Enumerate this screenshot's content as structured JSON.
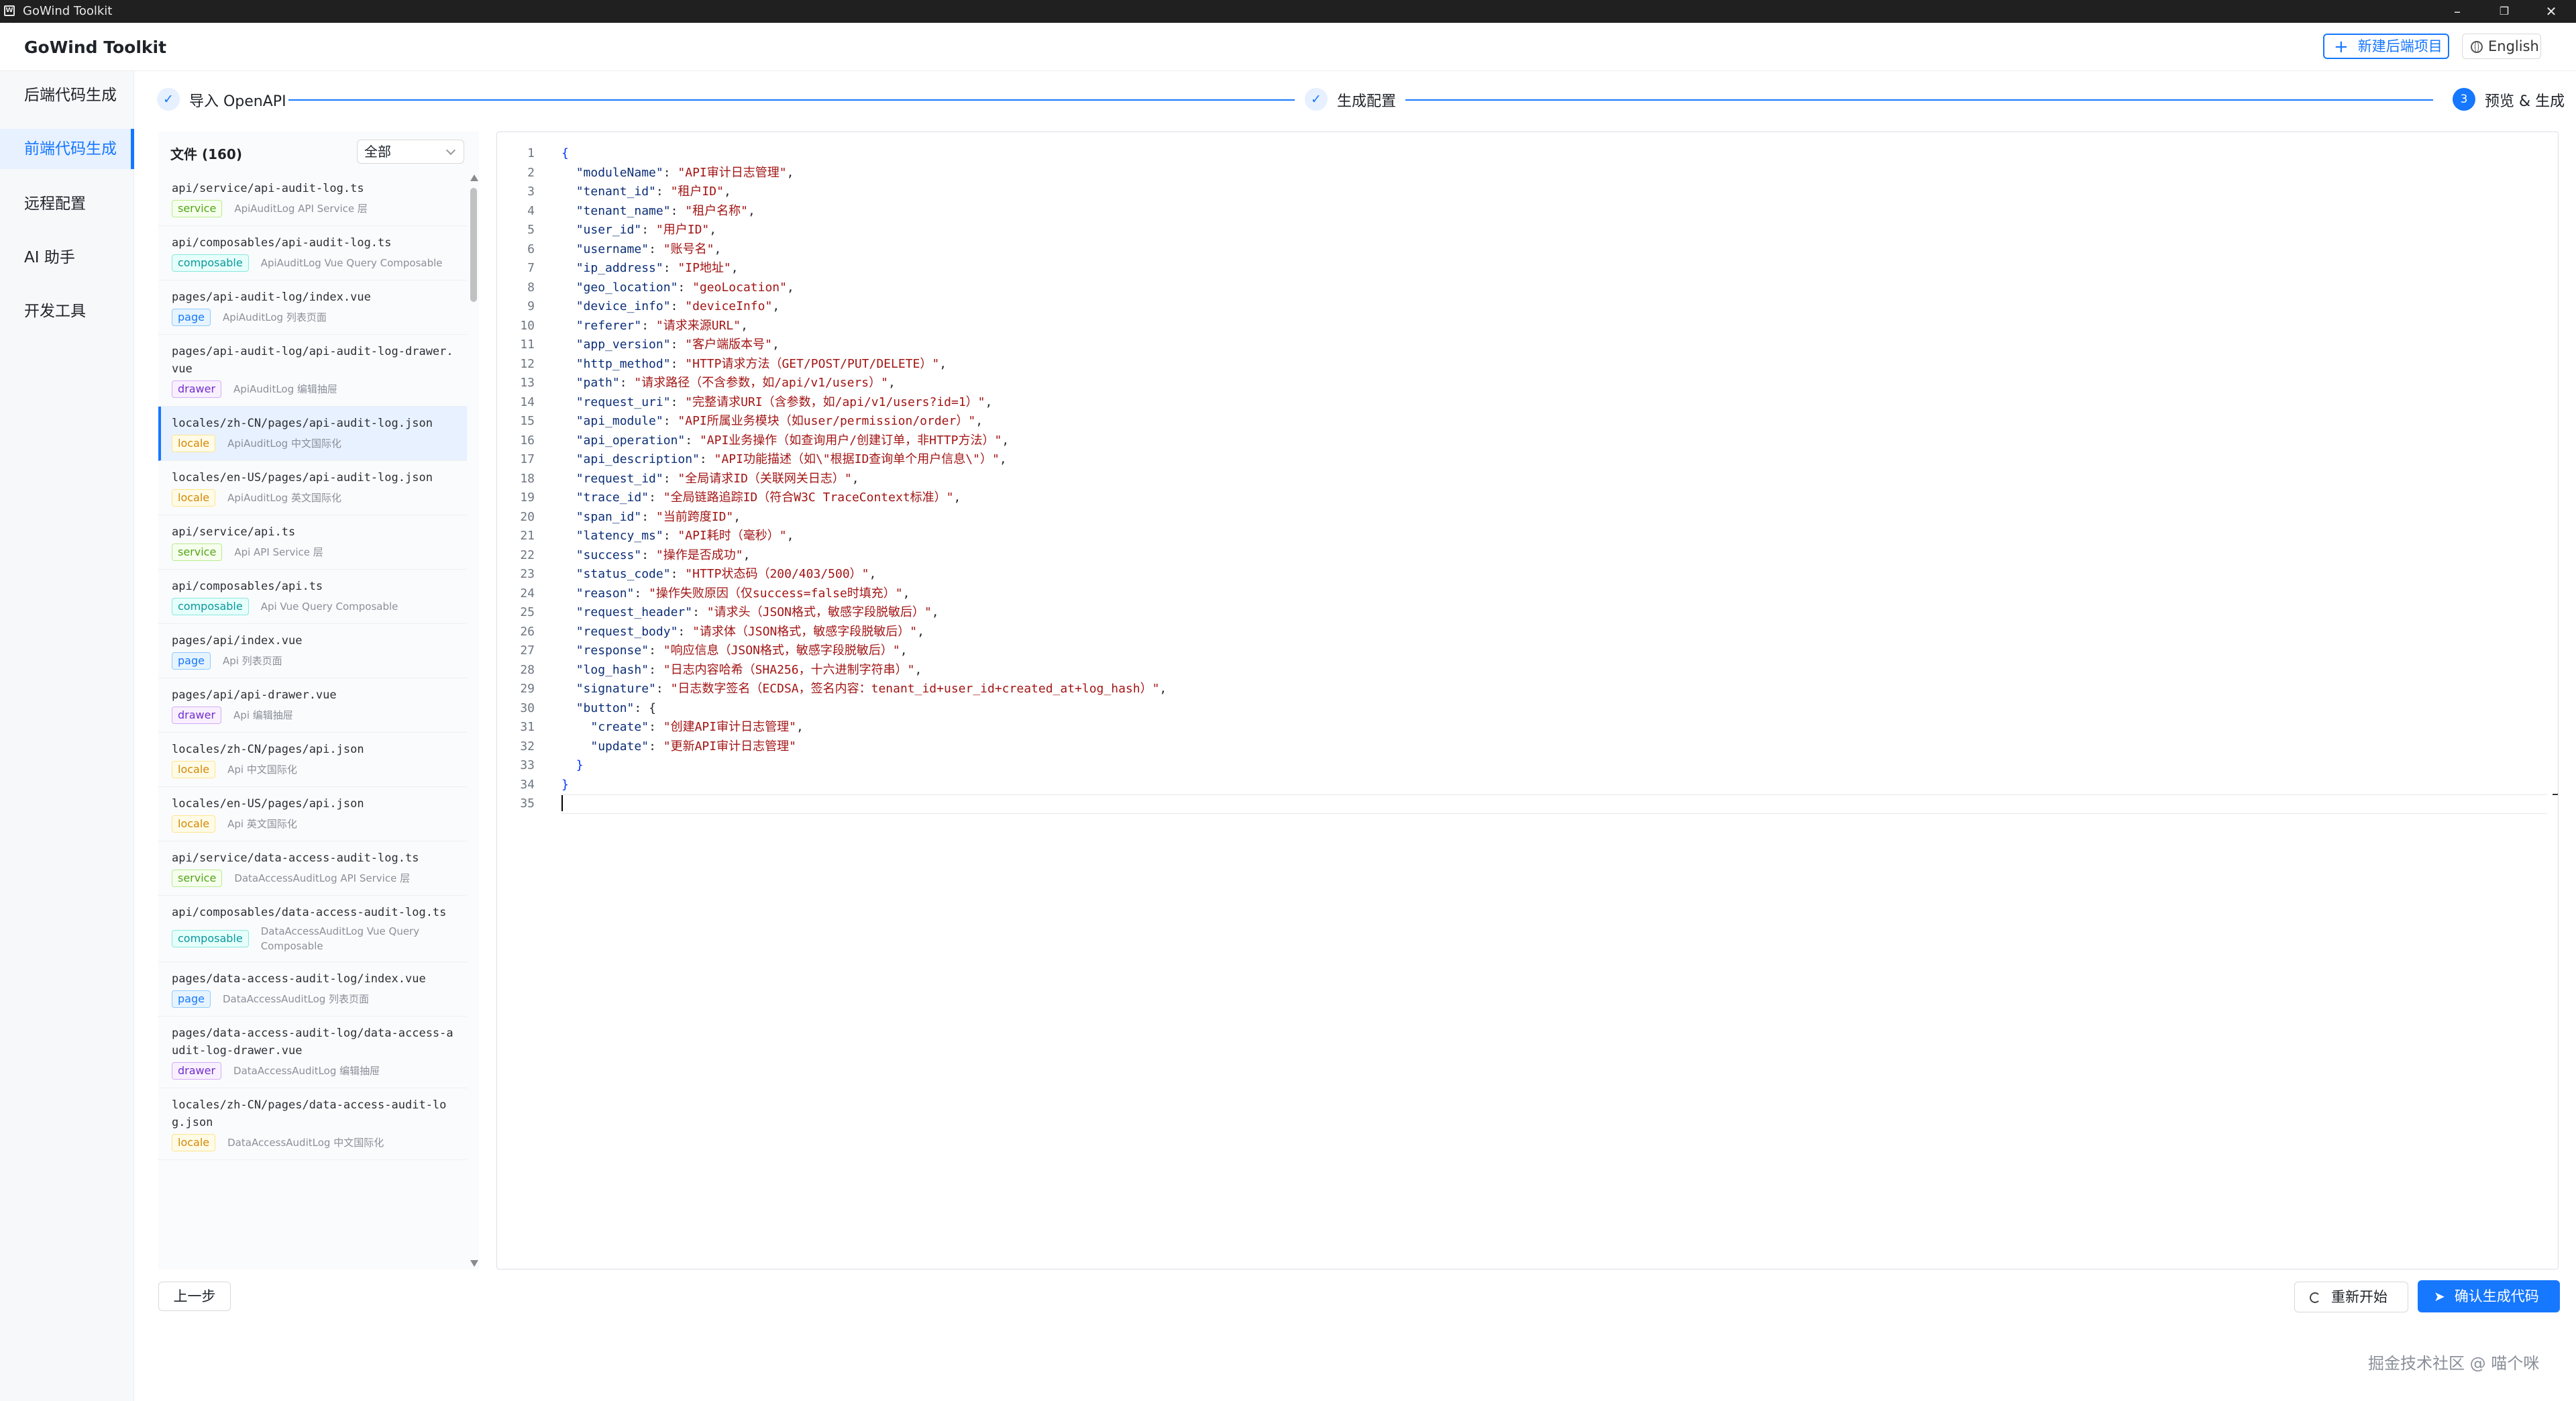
{
  "window": {
    "title": "GoWind Toolkit",
    "icon_letter": "W",
    "controls": {
      "minimize": "–",
      "restore": "❐",
      "close": "✕"
    }
  },
  "header": {
    "brand": "GoWind Toolkit",
    "new_backend_button": "新建后端项目",
    "new_backend_icon": "+",
    "language_button": "English"
  },
  "sidebar": {
    "items": [
      {
        "label": "后端代码生成",
        "active": false
      },
      {
        "label": "前端代码生成",
        "active": true
      },
      {
        "label": "远程配置",
        "active": false
      },
      {
        "label": "AI 助手",
        "active": false
      },
      {
        "label": "开发工具",
        "active": false
      }
    ]
  },
  "steps": [
    {
      "label": "导入 OpenAPI",
      "status": "done",
      "icon": "✓"
    },
    {
      "label": "生成配置",
      "status": "done",
      "icon": "✓"
    },
    {
      "label": "预览 & 生成",
      "status": "current",
      "icon": "3"
    }
  ],
  "file_panel": {
    "title": "文件 (160)",
    "filter_value": "全部",
    "files": [
      {
        "path": "api/service/api-audit-log.ts",
        "tag": "service",
        "desc": "ApiAuditLog API Service 层",
        "active": false
      },
      {
        "path": "api/composables/api-audit-log.ts",
        "tag": "composable",
        "desc": "ApiAuditLog Vue Query Composable",
        "active": false
      },
      {
        "path": "pages/api-audit-log/index.vue",
        "tag": "page",
        "desc": "ApiAuditLog 列表页面",
        "active": false
      },
      {
        "path": "pages/api-audit-log/api-audit-log-drawer.vue",
        "tag": "drawer",
        "desc": "ApiAuditLog 编辑抽屉",
        "active": false
      },
      {
        "path": "locales/zh-CN/pages/api-audit-log.json",
        "tag": "locale",
        "desc": "ApiAuditLog 中文国际化",
        "active": true
      },
      {
        "path": "locales/en-US/pages/api-audit-log.json",
        "tag": "locale",
        "desc": "ApiAuditLog 英文国际化",
        "active": false
      },
      {
        "path": "api/service/api.ts",
        "tag": "service",
        "desc": "Api API Service 层",
        "active": false
      },
      {
        "path": "api/composables/api.ts",
        "tag": "composable",
        "desc": "Api Vue Query Composable",
        "active": false
      },
      {
        "path": "pages/api/index.vue",
        "tag": "page",
        "desc": "Api 列表页面",
        "active": false
      },
      {
        "path": "pages/api/api-drawer.vue",
        "tag": "drawer",
        "desc": "Api 编辑抽屉",
        "active": false
      },
      {
        "path": "locales/zh-CN/pages/api.json",
        "tag": "locale",
        "desc": "Api 中文国际化",
        "active": false
      },
      {
        "path": "locales/en-US/pages/api.json",
        "tag": "locale",
        "desc": "Api 英文国际化",
        "active": false
      },
      {
        "path": "api/service/data-access-audit-log.ts",
        "tag": "service",
        "desc": "DataAccessAuditLog API Service 层",
        "active": false
      },
      {
        "path": "api/composables/data-access-audit-log.ts",
        "tag": "composable",
        "desc": "DataAccessAuditLog Vue Query Composable",
        "active": false
      },
      {
        "path": "pages/data-access-audit-log/index.vue",
        "tag": "page",
        "desc": "DataAccessAuditLog 列表页面",
        "active": false
      },
      {
        "path": "pages/data-access-audit-log/data-access-audit-log-drawer.vue",
        "tag": "drawer",
        "desc": "DataAccessAuditLog 编辑抽屉",
        "active": false
      },
      {
        "path": "locales/zh-CN/pages/data-access-audit-log.json",
        "tag": "locale",
        "desc": "DataAccessAuditLog 中文国际化",
        "active": false
      }
    ]
  },
  "editor": {
    "current_line": 35,
    "lines": [
      "{",
      "  \"moduleName\": \"API审计日志管理\",",
      "  \"tenant_id\": \"租户ID\",",
      "  \"tenant_name\": \"租户名称\",",
      "  \"user_id\": \"用户ID\",",
      "  \"username\": \"账号名\",",
      "  \"ip_address\": \"IP地址\",",
      "  \"geo_location\": \"geoLocation\",",
      "  \"device_info\": \"deviceInfo\",",
      "  \"referer\": \"请求来源URL\",",
      "  \"app_version\": \"客户端版本号\",",
      "  \"http_method\": \"HTTP请求方法（GET/POST/PUT/DELETE）\",",
      "  \"path\": \"请求路径（不含参数，如/api/v1/users）\",",
      "  \"request_uri\": \"完整请求URI（含参数，如/api/v1/users?id=1）\",",
      "  \"api_module\": \"API所属业务模块（如user/permission/order）\",",
      "  \"api_operation\": \"API业务操作（如查询用户/创建订单，非HTTP方法）\",",
      "  \"api_description\": \"API功能描述（如\\\"根据ID查询单个用户信息\\\"）\",",
      "  \"request_id\": \"全局请求ID（关联网关日志）\",",
      "  \"trace_id\": \"全局链路追踪ID（符合W3C TraceContext标准）\",",
      "  \"span_id\": \"当前跨度ID\",",
      "  \"latency_ms\": \"API耗时（毫秒）\",",
      "  \"success\": \"操作是否成功\",",
      "  \"status_code\": \"HTTP状态码（200/403/500）\",",
      "  \"reason\": \"操作失败原因（仅success=false时填充）\",",
      "  \"request_header\": \"请求头（JSON格式，敏感字段脱敏后）\",",
      "  \"request_body\": \"请求体（JSON格式，敏感字段脱敏后）\",",
      "  \"response\": \"响应信息（JSON格式，敏感字段脱敏后）\",",
      "  \"log_hash\": \"日志内容哈希（SHA256，十六进制字符串）\",",
      "  \"signature\": \"日志数字签名（ECDSA，签名内容：tenant_id+user_id+created_at+log_hash）\",",
      "  \"button\": {",
      "    \"create\": \"创建API审计日志管理\",",
      "    \"update\": \"更新API审计日志管理\"",
      "  }",
      "}",
      ""
    ]
  },
  "footer": {
    "prev_button": "上一步",
    "restart_button": "重新开始",
    "confirm_button": "确认生成代码",
    "watermark": "掘金技术社区 @ 喵个咪"
  },
  "colors": {
    "accent": "#1677ff",
    "sidebar_bg": "#f7f8fa",
    "titlebar_bg": "#202020"
  },
  "icons": {
    "step_done": "check-icon",
    "restart": "refresh-icon",
    "confirm": "send-icon",
    "language": "globe-icon",
    "new_backend": "plus-icon"
  }
}
